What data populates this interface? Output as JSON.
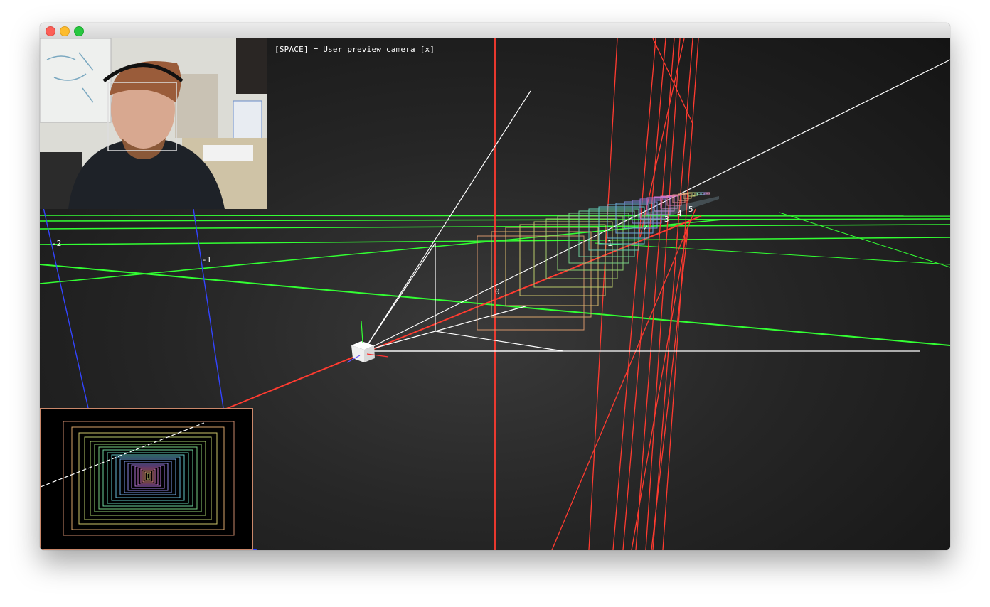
{
  "window": {
    "traffic_lights": [
      "close",
      "minimize",
      "zoom"
    ]
  },
  "overlay": {
    "hint": "[SPACE] = User preview camera [x]"
  },
  "scene": {
    "axis_labels": [
      "-2",
      "-1",
      "0",
      "1",
      "2",
      "3",
      "4",
      "5"
    ],
    "colors": {
      "grid": "#33ff33",
      "x_axis": "#ff3333",
      "y_axis": "#3333ff",
      "frustum": "#ffffff",
      "face_box": "#dddddd"
    }
  },
  "webcam": {
    "label_icon": "webcam-feed"
  },
  "preview_camera": {
    "label_icon": "nested-frames"
  }
}
